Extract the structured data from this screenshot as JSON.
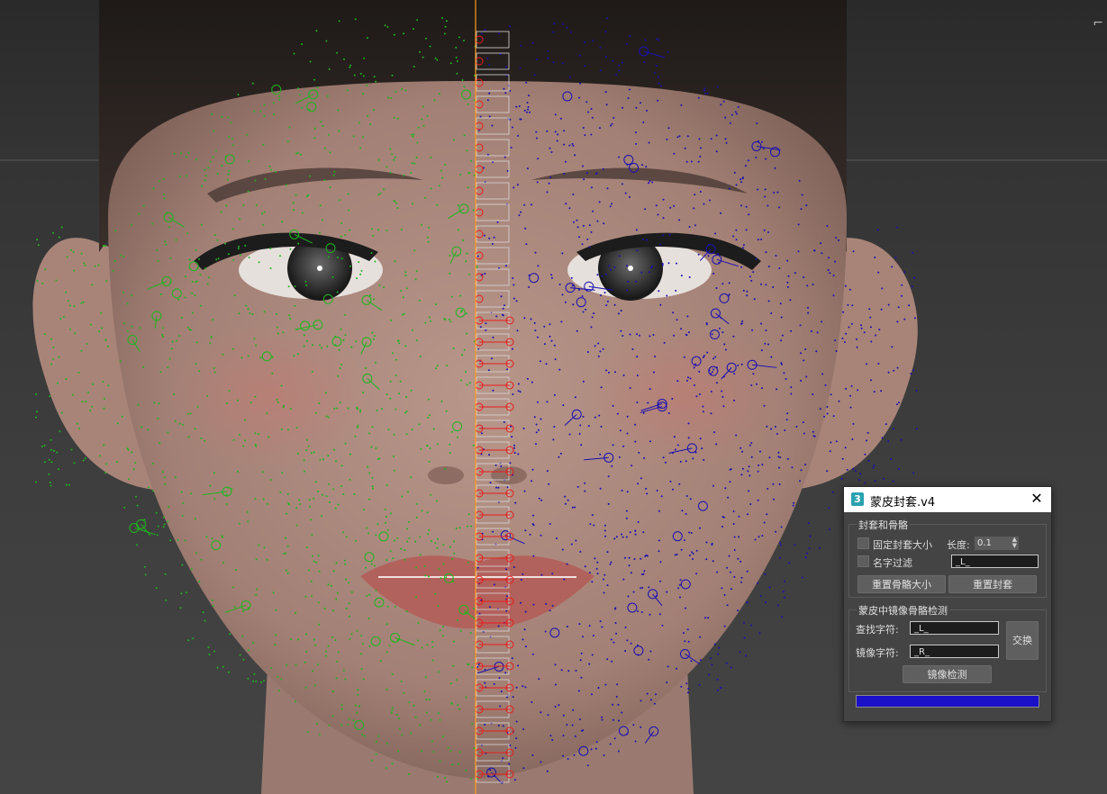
{
  "dialog": {
    "app_icon": "3",
    "title": "蒙皮封套.v4",
    "close_label": "✕",
    "group1": {
      "title": "封套和骨骼",
      "fix_envelope_label": "固定封套大小",
      "length_label": "长度:",
      "length_value": "0.1",
      "name_filter_label": "名字过滤",
      "name_filter_value": "_L_",
      "reset_bone_size_button": "重置骨骼大小",
      "reset_envelope_button": "重置封套"
    },
    "group2": {
      "title": "蒙皮中镜像骨骼检测",
      "find_label": "查找字符:",
      "find_value": "_L_",
      "mirror_label": "镜像字符:",
      "mirror_value": "_R_",
      "swap_button": "交换",
      "mirror_check_button": "镜像检测"
    },
    "progress": 1.0,
    "progress_color": "#1a10c8"
  },
  "colors": {
    "left_vertices": "#1fb51f",
    "right_vertices": "#1a10b0",
    "center_bones": "#e81c1c",
    "center_line": "#ff9a1f"
  },
  "viewport_corner_glyph": "⌐"
}
